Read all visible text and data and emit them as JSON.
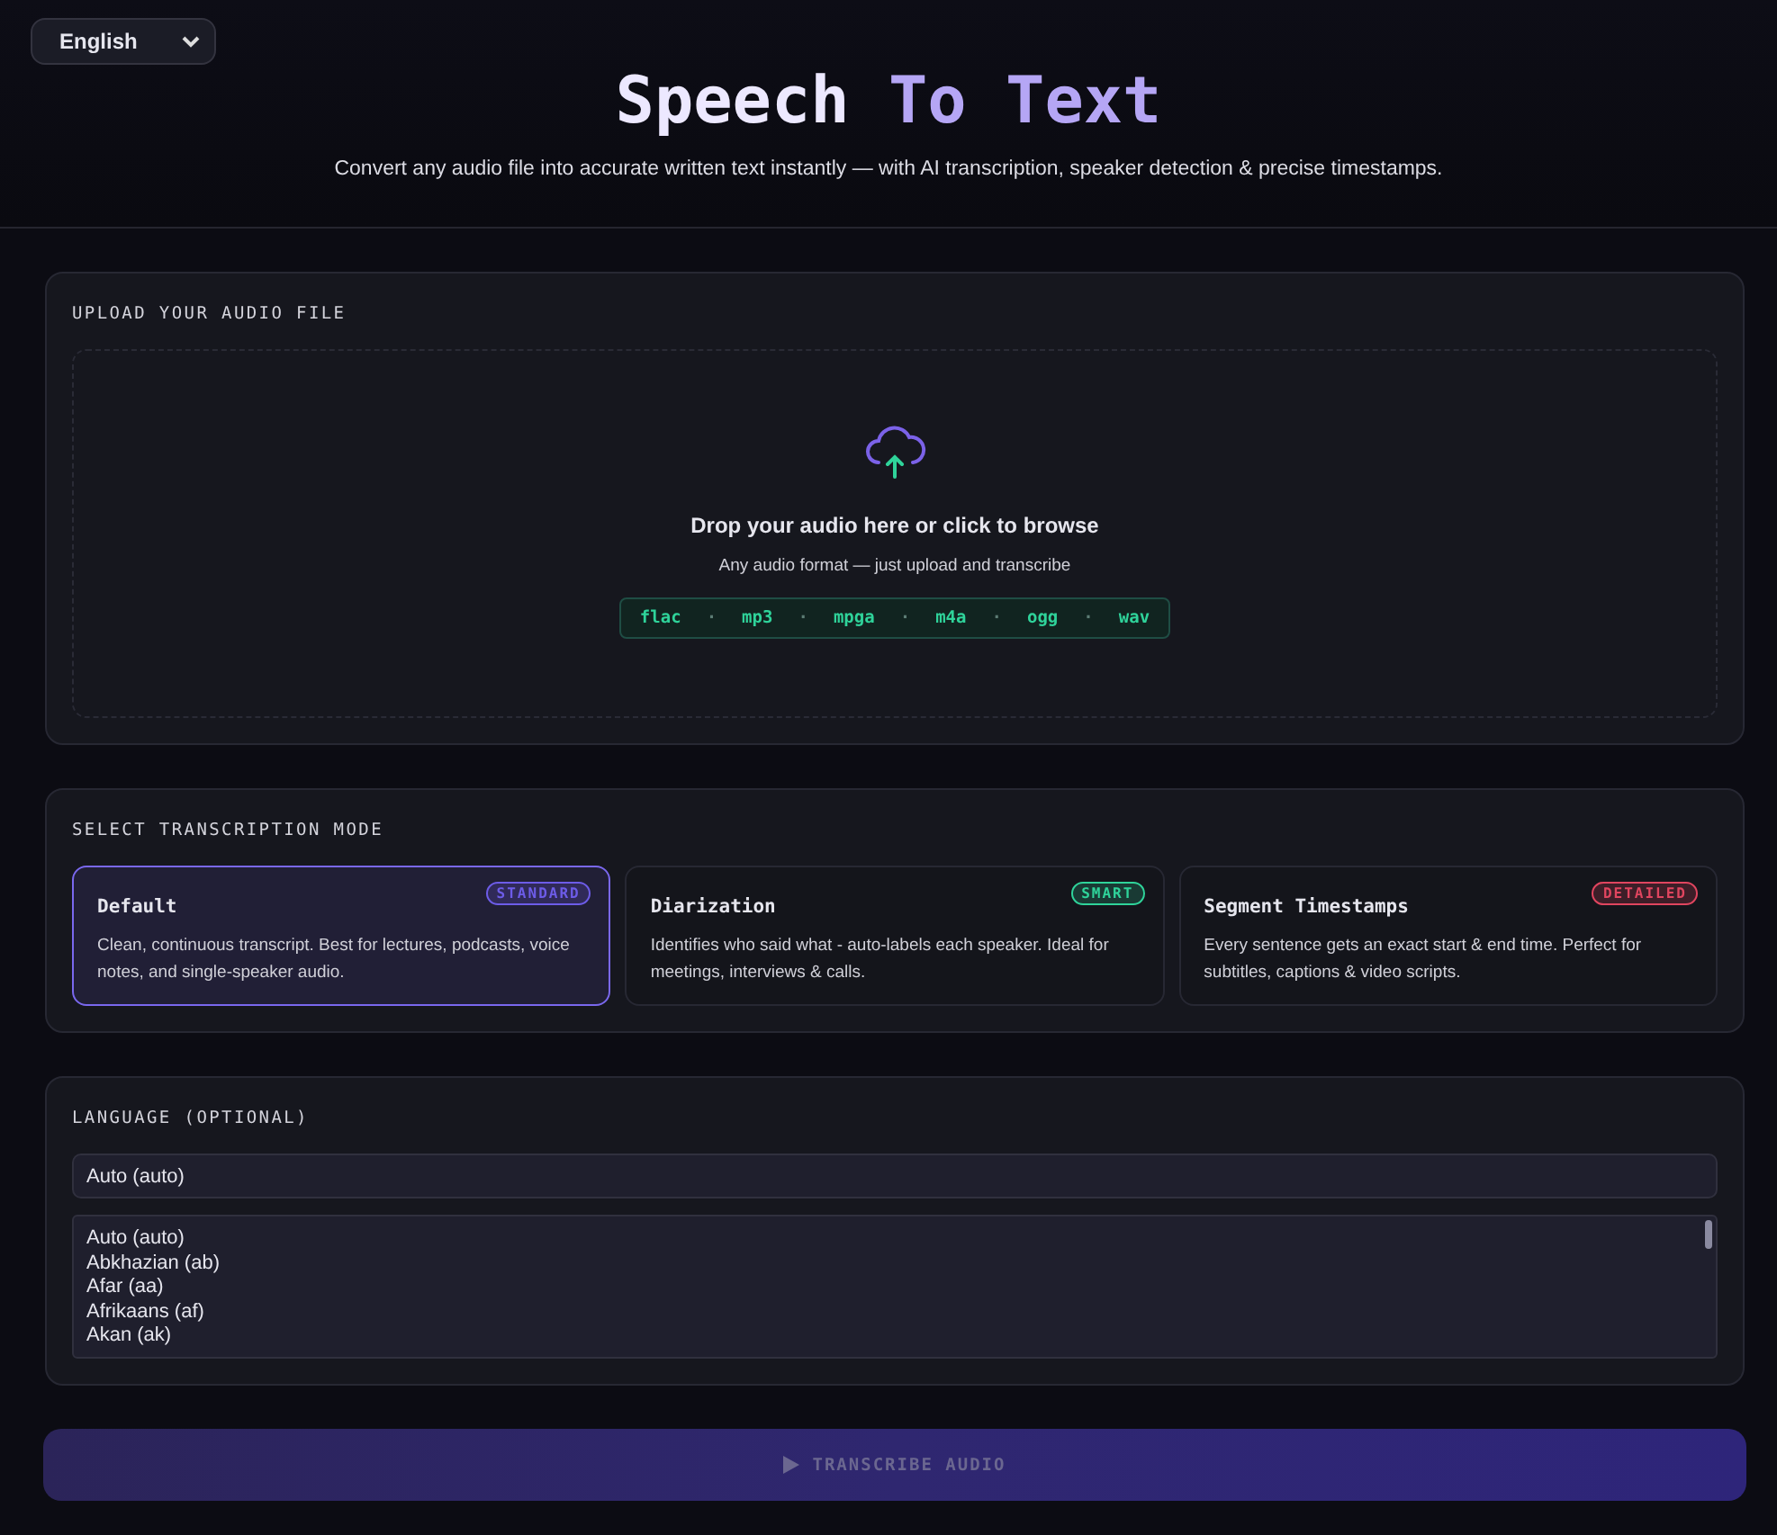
{
  "language_select": {
    "value": "English"
  },
  "header": {
    "title_start": "Speech",
    "title_end": "To Text",
    "subtitle": "Convert any audio file into accurate written text instantly — with AI transcription, speaker detection & precise timestamps."
  },
  "upload": {
    "heading": "UPLOAD YOUR AUDIO FILE",
    "prompt": "Drop your audio here or click to browse",
    "hint": "Any audio format — just upload and transcribe",
    "separator": "·",
    "formats": [
      "flac",
      "mp3",
      "mpga",
      "m4a",
      "ogg",
      "wav"
    ]
  },
  "mode": {
    "heading": "SELECT TRANSCRIPTION MODE",
    "options": [
      {
        "title": "Default",
        "badge": "STANDARD",
        "color": "#6d5ce8",
        "description": "Clean, continuous transcript. Best for lectures, podcasts, voice notes, and single-speaker audio.",
        "selected": true
      },
      {
        "title": "Diarization",
        "badge": "SMART",
        "color": "#2fd39a",
        "description": "Identifies who said what - auto-labels each speaker. Ideal for meetings, interviews & calls.",
        "selected": false
      },
      {
        "title": "Segment Timestamps",
        "badge": "DETAILED",
        "color": "#e0455f",
        "description": "Every sentence gets an exact start & end time. Perfect for subtitles, captions & video scripts.",
        "selected": false
      }
    ]
  },
  "language": {
    "heading": "LANGUAGE (OPTIONAL)",
    "value": "Auto (auto)",
    "options": [
      "Auto (auto)",
      "Abkhazian (ab)",
      "Afar (aa)",
      "Afrikaans (af)",
      "Akan (ak)"
    ]
  },
  "transcribe_button": {
    "label": "TRANSCRIBE AUDIO",
    "disabled": true
  }
}
